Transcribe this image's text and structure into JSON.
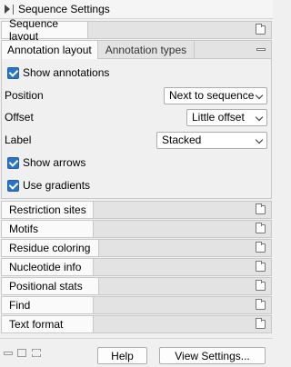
{
  "window": {
    "title": "Sequence Settings"
  },
  "sections": {
    "sequence_layout": "Sequence layout",
    "restriction_sites": "Restriction sites",
    "motifs": "Motifs",
    "residue_coloring": "Residue coloring",
    "nucleotide_info": "Nucleotide info",
    "positional_stats": "Positional stats",
    "find": "Find",
    "text_format": "Text format"
  },
  "annotation": {
    "tabs": [
      "Annotation layout",
      "Annotation types"
    ],
    "active_tab": "Annotation layout",
    "show_annotations": {
      "label": "Show annotations",
      "checked": true
    },
    "position": {
      "label": "Position",
      "value": "Next to sequence"
    },
    "offset": {
      "label": "Offset",
      "value": "Little offset"
    },
    "label_field": {
      "label": "Label",
      "value": "Stacked"
    },
    "show_arrows": {
      "label": "Show arrows",
      "checked": true
    },
    "use_gradients": {
      "label": "Use gradients",
      "checked": true
    }
  },
  "footer": {
    "help_label": "Help",
    "view_settings_label": "View Settings..."
  }
}
